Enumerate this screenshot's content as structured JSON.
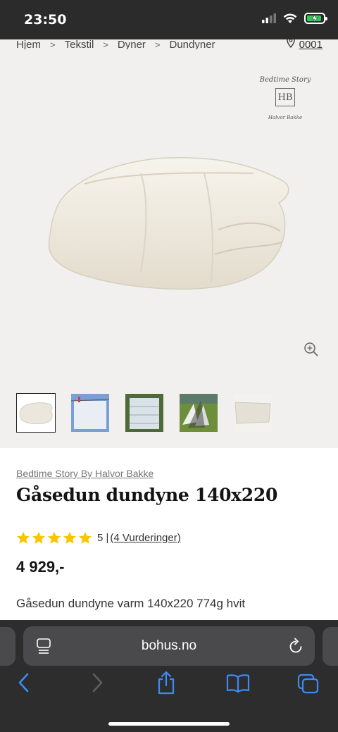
{
  "status_bar": {
    "time": "23:50"
  },
  "breadcrumb": [
    "Hjem",
    "Tekstil",
    "Dyner",
    "Dundyner"
  ],
  "store": {
    "code": "0001"
  },
  "brand_logo": {
    "script": "Bedtime Story",
    "monogram": "HB",
    "signature": "Halvor Bakke"
  },
  "product": {
    "brand": "Bedtime Story By Halvor Bakke",
    "title": "Gåsedun dundyne 140x220",
    "rating": {
      "stars": 5,
      "score": "5 |",
      "reviews": "(4 Vurderinger)"
    },
    "price": "4 929,-",
    "description": "Gåsedun dundyne varm 140x220 774g hvit"
  },
  "thumbnails": [
    "duvet-front",
    "duvet-on-line",
    "duvet-stack",
    "duvet-outdoor",
    "duvet-fabric"
  ],
  "browser": {
    "domain": "bohus.no"
  },
  "colors": {
    "star": "#f7c600",
    "safari_blue": "#3d8bf6",
    "toolbar": "#2d2d2e",
    "gallery_bg": "#f2f0ee"
  }
}
